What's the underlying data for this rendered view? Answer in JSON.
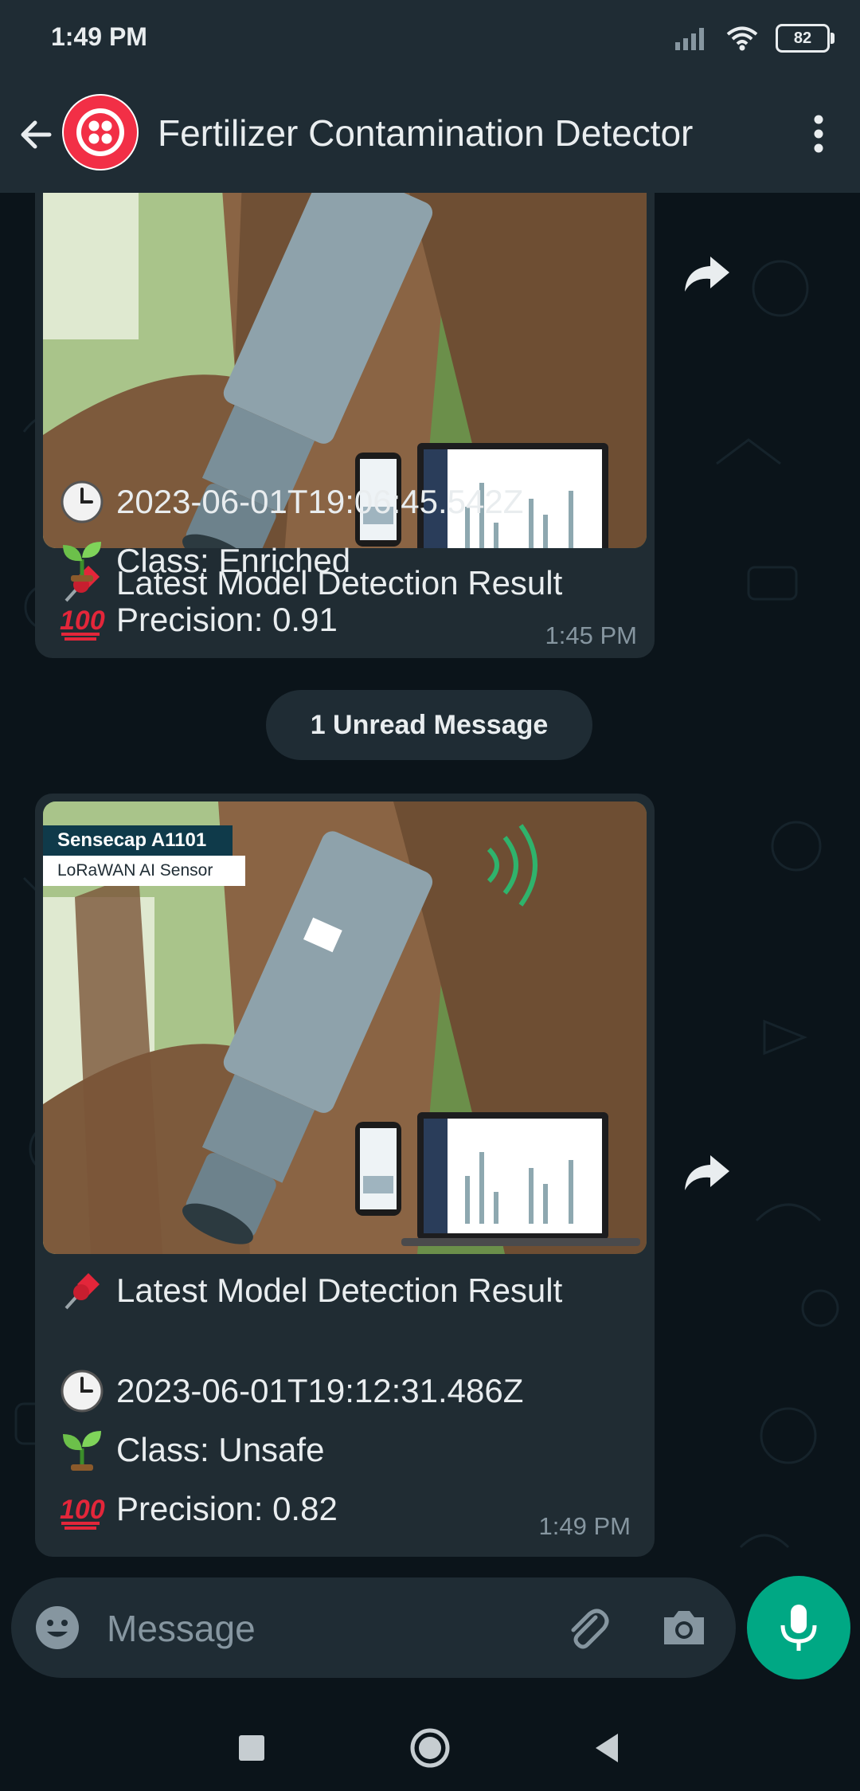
{
  "status_bar": {
    "time": "1:49 PM",
    "battery": "82",
    "icons": [
      "signal-icon",
      "wifi-icon",
      "battery-icon"
    ]
  },
  "header": {
    "title": "Fertilizer Contamination Detector",
    "icons": [
      "back-arrow-icon",
      "twilio-logo",
      "more-vert-icon"
    ]
  },
  "messages": [
    {
      "title": "Latest Model Detection Result",
      "timestamp": "2023-06-01T19:06:45.542Z",
      "class_text": "Class: Enriched",
      "precision_text": "Precision: 0.91",
      "time": "1:45 PM",
      "icons": [
        "pushpin-icon",
        "clock-icon",
        "seedling-icon",
        "hundred-points-icon",
        "forward-icon"
      ]
    },
    {
      "image_badge": "Sensecap A1101",
      "image_subtitle": "LoRaWAN AI Sensor",
      "title": "Latest Model Detection Result",
      "timestamp": "2023-06-01T19:12:31.486Z",
      "class_text": "Class: Unsafe",
      "precision_text": "Precision: 0.82",
      "time": "1:49 PM",
      "icons": [
        "pushpin-icon",
        "clock-icon",
        "seedling-icon",
        "hundred-points-icon",
        "forward-icon"
      ]
    }
  ],
  "unread_divider": "1 Unread Message",
  "composer": {
    "placeholder": "Message",
    "icons": [
      "emoji-icon",
      "attach-icon",
      "camera-icon",
      "mic-icon"
    ]
  },
  "navigation_bar": {
    "icons": [
      "recents-icon",
      "home-icon",
      "back-icon"
    ]
  },
  "colors": {
    "header": "#1f2c34",
    "chat_background": "#0b141a",
    "bubble": "#202c33",
    "accent": "#00a884",
    "muted_text": "#8696a0"
  }
}
